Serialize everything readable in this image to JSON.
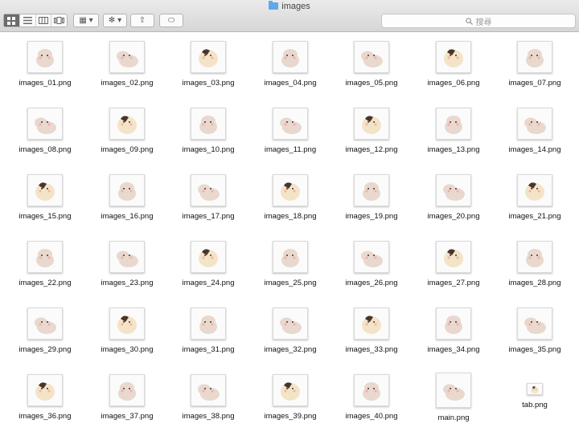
{
  "window": {
    "title": "images"
  },
  "toolbar": {
    "view_icons": [
      "icon-view-icon",
      "list-view-icon",
      "column-view-icon",
      "coverflow-view-icon"
    ],
    "arrange_glyph": "▦ ▾",
    "action_glyph": "✻ ▾",
    "share_glyph": "⇧",
    "tag_glyph": "⬭"
  },
  "search": {
    "placeholder": "搜尋"
  },
  "files": [
    "images_01.png",
    "images_02.png",
    "images_03.png",
    "images_04.png",
    "images_05.png",
    "images_06.png",
    "images_07.png",
    "images_08.png",
    "images_09.png",
    "images_10.png",
    "images_11.png",
    "images_12.png",
    "images_13.png",
    "images_14.png",
    "images_15.png",
    "images_16.png",
    "images_17.png",
    "images_18.png",
    "images_19.png",
    "images_20.png",
    "images_21.png",
    "images_22.png",
    "images_23.png",
    "images_24.png",
    "images_25.png",
    "images_26.png",
    "images_27.png",
    "images_28.png",
    "images_29.png",
    "images_30.png",
    "images_31.png",
    "images_32.png",
    "images_33.png",
    "images_34.png",
    "images_35.png",
    "images_36.png",
    "images_37.png",
    "images_38.png",
    "images_39.png",
    "images_40.png",
    "main.png",
    "tab.png"
  ],
  "colors": {
    "accent": "#5fa9ea",
    "sticker_fur": "#e8d8ce",
    "sticker_dark": "#4a352a",
    "sticker_blush": "#f4a3a3"
  }
}
